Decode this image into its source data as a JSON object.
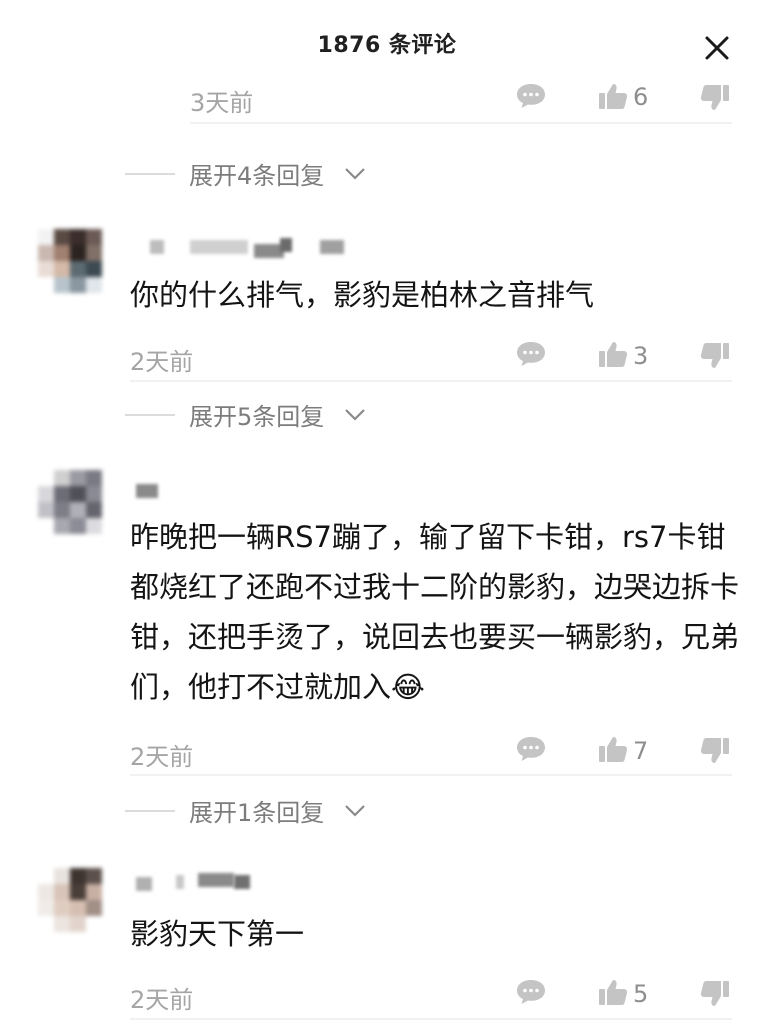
{
  "header": {
    "title": "1876 条评论"
  },
  "comments": [
    {
      "text": "",
      "time": "3天前",
      "likes": "6",
      "replies_label": "展开4条回复"
    },
    {
      "text": "你的什么排气，影豹是柏林之音排气",
      "time": "2天前",
      "likes": "3",
      "replies_label": "展开5条回复"
    },
    {
      "text": "昨晚把一辆RS7蹦了，输了留下卡钳，rs7卡钳都烧红了还跑不过我十二阶的影豹，边哭边拆卡钳，还把手烫了，说回去也要买一辆影豹，兄弟们，他打不过就加入",
      "emoji": "😂",
      "time": "2天前",
      "likes": "7",
      "replies_label": "展开1条回复"
    },
    {
      "text": "影豹天下第一",
      "time": "2天前",
      "likes": "5"
    }
  ],
  "colors": {
    "text": "#141414",
    "meta": "#a5a5a5",
    "icon": "#c4c4c4",
    "divider": "#f1f1f1"
  }
}
